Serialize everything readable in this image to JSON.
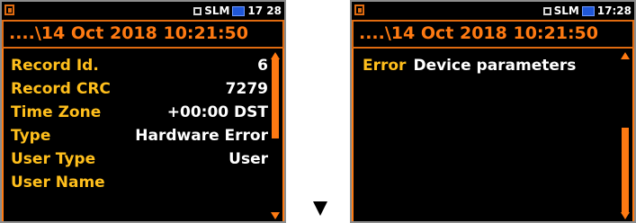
{
  "left_screen": {
    "status": {
      "mode": "SLM",
      "time": "17 28"
    },
    "header": "....\\14 Oct 2018 10:21:50",
    "rows": [
      {
        "label": "Record Id.",
        "value": "6"
      },
      {
        "label": "Record CRC",
        "value": "7279"
      },
      {
        "label": "Time Zone",
        "value": "+00:00 DST"
      },
      {
        "label": "Type",
        "value": "Hardware Error"
      },
      {
        "label": "User Type",
        "value": "User"
      },
      {
        "label": "User Name",
        "value": ""
      }
    ]
  },
  "right_screen": {
    "status": {
      "mode": "SLM",
      "time": "17:28"
    },
    "header": "....\\14 Oct 2018 10:21:50",
    "error": {
      "label": "Error",
      "value": "Device parameters"
    }
  },
  "icons": {
    "document": "document-icon",
    "square": "square-icon",
    "pc": "pc-connection-icon",
    "next": "arrow-down-icon"
  },
  "colors": {
    "accent": "#ff7a12",
    "label": "#ffbf1c",
    "value": "#ffffff",
    "background": "#000000",
    "pc_icon": "#1f57d8"
  }
}
